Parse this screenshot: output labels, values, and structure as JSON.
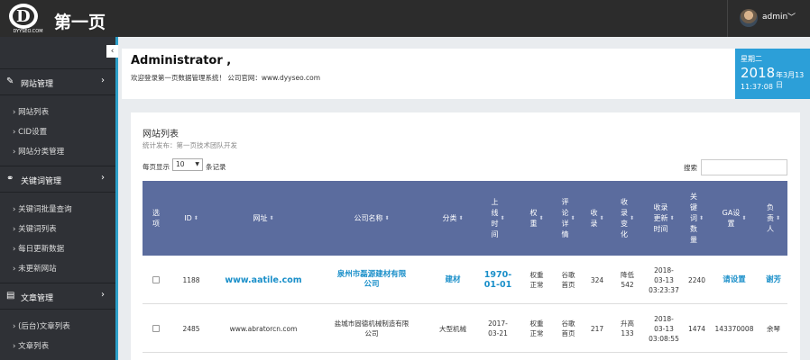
{
  "header": {
    "logo_text": "D",
    "logo_small": "DYYSEO.COM",
    "site_name": "第一页",
    "user_name": "admin",
    "user_caret": "﹀"
  },
  "sidebar": {
    "collapse_icon": "‹",
    "groups": [
      {
        "label": "网站管理",
        "icon": "edit-icon",
        "glyph": "✎",
        "items": [
          "网站列表",
          "CID设置",
          "网站分类管理"
        ]
      },
      {
        "label": "关键词管理",
        "icon": "link-icon",
        "glyph": "⚭",
        "items": [
          "关键词批量查询",
          "关键词列表",
          "每日更新数据",
          "未更新网站"
        ]
      },
      {
        "label": "文章管理",
        "icon": "document-icon",
        "glyph": "▤",
        "items": [
          "(后台)文章列表",
          "文章列表"
        ]
      }
    ]
  },
  "welcome": {
    "title": "Administrator ,",
    "subtitle": "欢迎登录第一页数据管理系统！ 公司官网：www.dyyseo.com"
  },
  "date": {
    "weekday": "星期二",
    "year": "2018",
    "month_day": "年3月13日",
    "time": "11:37:08"
  },
  "panel": {
    "title": "网站列表",
    "subtitle": "统计发布：第一页技术团队开发",
    "length_prefix": "每页显示",
    "length_value": "10",
    "length_suffix": "条记录",
    "search_label": "搜索"
  },
  "table": {
    "columns": [
      {
        "label": "选\n项",
        "sort": false
      },
      {
        "label": "ID",
        "sort": true
      },
      {
        "label": "网址",
        "sort": true
      },
      {
        "label": "公司名称",
        "sort": true
      },
      {
        "label": "分类",
        "sort": true
      },
      {
        "label": "上\n线\n时\n间",
        "sort": true
      },
      {
        "label": "权\n重",
        "sort": true
      },
      {
        "label": "评\n论\n详\n情",
        "sort": true
      },
      {
        "label": "收\n录",
        "sort": true
      },
      {
        "label": "收\n录\n变\n化",
        "sort": true
      },
      {
        "label": "收录\n更新\n时间",
        "sort": true
      },
      {
        "label": "关\n键\n词\n数\n量",
        "sort": true
      },
      {
        "label": "GA设\n置",
        "sort": true
      },
      {
        "label": "负\n责\n人",
        "sort": true
      }
    ],
    "rows": [
      {
        "id": "1188",
        "url": "www.aatile.com",
        "company": "泉州市磊源建材有限\n公司",
        "category": "建材",
        "online": "1970-\n01-01",
        "weight": "权重\n正常",
        "review": "谷歌\n首页",
        "indexed": "324",
        "index_change": "降低\n542",
        "index_time": "2018-\n03-13\n03:23:37",
        "keywords": "2240",
        "ga": "请设置",
        "owner": "谢芳"
      },
      {
        "id": "2485",
        "url": "www.abratorcn.com",
        "company": "盐城市固德机械制造有限\n公司",
        "category": "大型机械",
        "online": "2017-\n03-21",
        "weight": "权重\n正常",
        "review": "谷歌\n首页",
        "indexed": "217",
        "index_change": "升高\n133",
        "index_time": "2018-\n03-13\n03:08:55",
        "keywords": "1474",
        "ga": "143370008",
        "owner": "余琴"
      }
    ]
  }
}
